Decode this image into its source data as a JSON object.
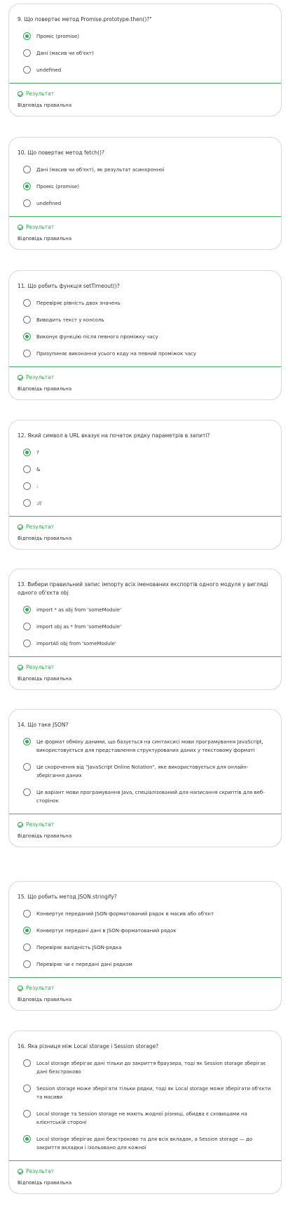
{
  "result_label": "Результат",
  "result_text": "Відповідь правильна",
  "accent_color": "#35a853",
  "questions": [
    {
      "title": "9. Що повертає метод Promise.prototype.then()?\"",
      "options": [
        "Проміс (promise)",
        "Дані (масив чи об'єкт)",
        "undefined"
      ],
      "selected": 0
    },
    {
      "title": "10. Що повертає метод fetch()?",
      "options": [
        "Дані (масив чи об'єкт), як результат асинхронної",
        "Проміс (promise)",
        "undefined"
      ],
      "selected": 1
    },
    {
      "title": "11. Що робить функція setTimeout()?",
      "options": [
        "Перевіряє рівність двох значень",
        "Виводить текст у консоль",
        "Виконує функцію після певного проміжку часу",
        "Призупиняє виконання усього коду на певний проміжок часу"
      ],
      "selected": 2
    },
    {
      "title": "12. Який символ в URL вказує на початок рядку параметрів в запиті?",
      "options": [
        "?",
        "&",
        ":",
        "://"
      ],
      "selected": 0
    },
    {
      "title": "13. Вибери правильний запис імпорту всіх іменованих експортів одного модуля у вигляді одного об'єкта obj",
      "options": [
        "import * as obj from 'someModule'",
        "import obj as * from 'someModule'",
        "importAll obj from 'someModule'"
      ],
      "selected": 0
    },
    {
      "title": "14. Що таке JSON?",
      "options": [
        "Це формат обміну даними, що базується на синтаксисі мови програмування JavaScript, використовується для представлення структурованих даних у текстовому форматі",
        "Це скорочення від \"JavaScript Online Notation\", яке використовується для онлайн-зберігання даних",
        "Це варіант мови програмування Java, спеціалізований для написання скриптів для веб-сторінок"
      ],
      "selected": 0
    },
    {
      "title": "15. Що робить метод JSON.stringify?",
      "options": [
        "Конвертує переданий JSON-форматований рядок в масив або об'єкт",
        "Конвертує передані дані в JSON-форматований рядок",
        "Перевіряє валідність JSON-рядка",
        "Перевіряє чи є передані дані рядком"
      ],
      "selected": 1
    },
    {
      "title": "16. Яка різниця між Local storage і Session storage?",
      "options": [
        "Local storage зберігає дані тільки до закриття браузера, тоді як Session storage зберігає дані безстроково",
        "Session storage може зберігати тільки рядки, тоді як Local storage може зберігати об'єкти та масиви",
        "Local storage та Session storage не мають жодної різниці, обидва є сховищами на клієнтській стороні",
        "Local storage зберігає дані безстроково та для всіх вкладок, а Session storage — до закриття вкладки і ізольовано для кожної"
      ],
      "selected": 3
    }
  ]
}
